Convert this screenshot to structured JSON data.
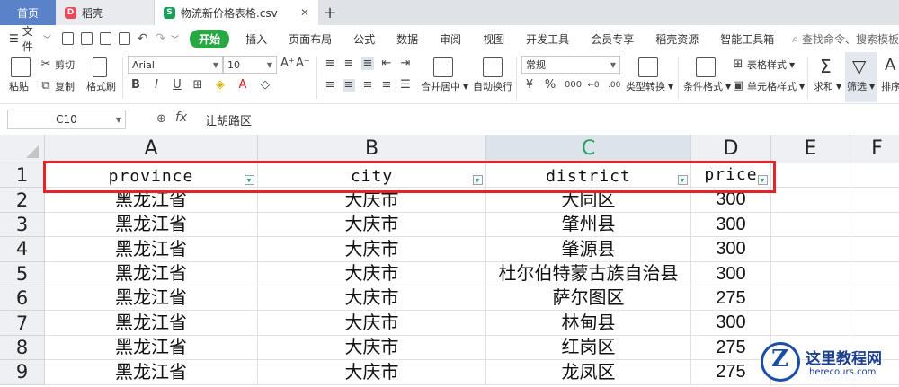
{
  "tabs": {
    "home": "首页",
    "docer": "稻壳",
    "file": "物流新价格表格.csv",
    "close": "✕",
    "add": "+"
  },
  "menu": {
    "file": "文件",
    "items": [
      "开始",
      "插入",
      "页面布局",
      "公式",
      "数据",
      "审阅",
      "视图",
      "开发工具",
      "会员专享",
      "稻壳资源",
      "智能工具箱"
    ],
    "search": "查找命令、搜索模板"
  },
  "ribbon": {
    "paste": "粘贴",
    "cut": "剪切",
    "copy": "复制",
    "format_painter": "格式刷",
    "font_name": "Arial",
    "font_size": "10",
    "number_format": "常规",
    "merge_center": "合并居中",
    "wrap_text": "自动换行",
    "type_convert": "类型转换",
    "conditional_format": "条件格式",
    "table_style": "表格样式",
    "cell_style": "单元格样式",
    "sum": "求和",
    "filter": "筛选",
    "sort": "排序"
  },
  "formula_bar": {
    "name_box": "C10",
    "fx": "fx",
    "value": "让胡路区"
  },
  "grid": {
    "columns": [
      "A",
      "B",
      "C",
      "D",
      "E",
      "F"
    ],
    "selected_column": "C",
    "row_numbers": [
      "1",
      "2",
      "3",
      "4",
      "5",
      "6",
      "7",
      "8",
      "9"
    ],
    "header_row": [
      "province",
      "city",
      "district",
      "price"
    ],
    "rows": [
      [
        "黑龙江省",
        "大庆市",
        "大同区",
        "300"
      ],
      [
        "黑龙江省",
        "大庆市",
        "肇州县",
        "300"
      ],
      [
        "黑龙江省",
        "大庆市",
        "肇源县",
        "300"
      ],
      [
        "黑龙江省",
        "大庆市",
        "杜尔伯特蒙古族自治县",
        "300"
      ],
      [
        "黑龙江省",
        "大庆市",
        "萨尔图区",
        "275"
      ],
      [
        "黑龙江省",
        "大庆市",
        "林甸县",
        "300"
      ],
      [
        "黑龙江省",
        "大庆市",
        "红岗区",
        "275"
      ],
      [
        "黑龙江省",
        "大庆市",
        "龙凤区",
        "275"
      ]
    ]
  },
  "watermark": {
    "logo_letter": "Z",
    "title": "这里教程网",
    "url": "herecours.com"
  },
  "colors": {
    "accent_green": "#28a745",
    "home_tab": "#5a82c8",
    "highlight_red": "#e5242a"
  }
}
